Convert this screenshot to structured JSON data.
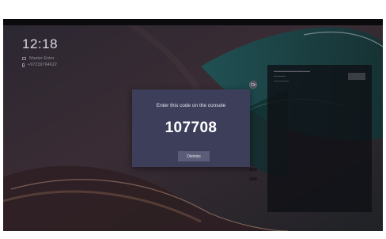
{
  "lockscreen": {
    "time": "12:18",
    "room_name": "Master Enter",
    "phone": "+97239764622"
  },
  "dialog": {
    "title": "Enter this code on the console",
    "code": "107708",
    "dismiss_label": "Dismiss"
  },
  "colors": {
    "dialog_bg": "#3d3e5a",
    "dismiss_bg": "#5b5c77",
    "panel_bg": "#0e1014"
  }
}
